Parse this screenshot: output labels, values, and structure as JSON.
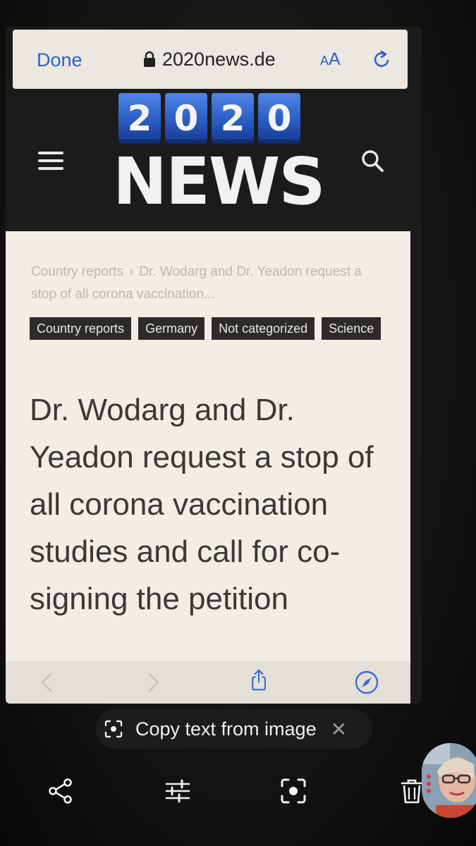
{
  "browser": {
    "done_label": "Done",
    "url": "2020news.de",
    "text_size_label": "AA"
  },
  "site": {
    "logo_digits": [
      "2",
      "0",
      "2",
      "0"
    ],
    "logo_word": "NEWS"
  },
  "article": {
    "breadcrumb": {
      "section": "Country reports",
      "separator": "›",
      "current": "Dr. Wodarg and Dr. Yeadon request a stop of all corona vaccination..."
    },
    "tags": [
      "Country reports",
      "Germany",
      "Not categorized",
      "Science"
    ],
    "headline": "Dr. Wodarg and Dr. Yeadon request a stop of all corona vaccination studies and call for co-signing the petition"
  },
  "browser_toolbar": {
    "icons": [
      "back-icon",
      "forward-icon",
      "share-icon",
      "compass-icon"
    ]
  },
  "overlay": {
    "copy_text_label": "Copy text from image",
    "close_glyph": "✕"
  },
  "bottom_toolbar": {
    "icons": [
      "share-icon",
      "adjust-icon",
      "lens-icon",
      "delete-icon"
    ]
  },
  "colors": {
    "accent_blue": "#2b63c9",
    "logo_blue": "#2a5cc4",
    "tag_background": "#2c2b29",
    "card_background": "#f2eee6"
  }
}
